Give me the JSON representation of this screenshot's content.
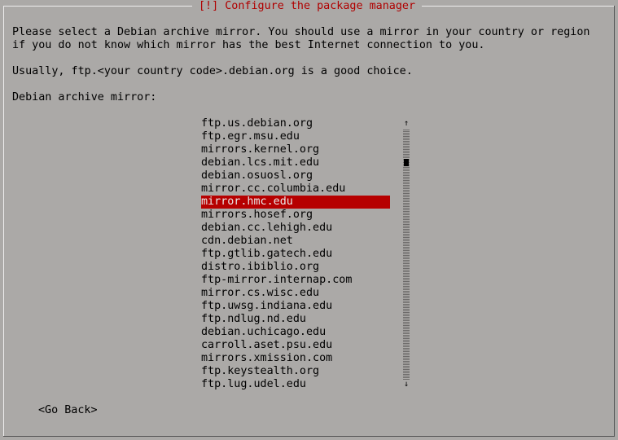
{
  "dialog": {
    "title": "[!] Configure the package manager"
  },
  "content": {
    "line1": "Please select a Debian archive mirror. You should use a mirror in your country or region",
    "line2": "if you do not know which mirror has the best Internet connection to you.",
    "hint": "Usually, ftp.<your country code>.debian.org is a good choice.",
    "prompt": "Debian archive mirror:"
  },
  "mirrors": [
    "ftp.us.debian.org",
    "ftp.egr.msu.edu",
    "mirrors.kernel.org",
    "debian.lcs.mit.edu",
    "debian.osuosl.org",
    "mirror.cc.columbia.edu",
    "mirror.hmc.edu",
    "mirrors.hosef.org",
    "debian.cc.lehigh.edu",
    "cdn.debian.net",
    "ftp.gtlib.gatech.edu",
    "distro.ibiblio.org",
    "ftp-mirror.internap.com",
    "mirror.cs.wisc.edu",
    "ftp.uwsg.indiana.edu",
    "ftp.ndlug.nd.edu",
    "debian.uchicago.edu",
    "carroll.aset.psu.edu",
    "mirrors.xmission.com",
    "ftp.keystealth.org",
    "ftp.lug.udel.edu"
  ],
  "selected_index": 6,
  "scrollbar": {
    "up_arrow": "↑",
    "down_arrow": "↓"
  },
  "buttons": {
    "go_back": "<Go Back>"
  },
  "colors": {
    "background": "#aba9a7",
    "title_text": "#b00000",
    "selection": "#b60000"
  }
}
